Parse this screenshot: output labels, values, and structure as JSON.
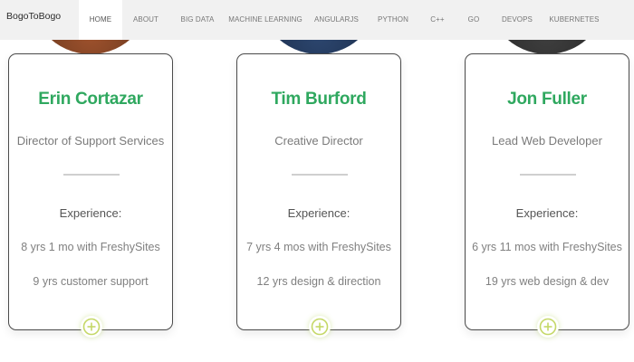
{
  "brand": "BogoToBogo",
  "nav": {
    "items": [
      {
        "label": "Home",
        "active": true
      },
      {
        "label": "About",
        "active": false
      },
      {
        "label": "Big Data",
        "active": false
      },
      {
        "label": "Machine Learning",
        "active": false
      },
      {
        "label": "AngularJS",
        "active": false
      },
      {
        "label": "Python",
        "active": false
      },
      {
        "label": "C++",
        "active": false
      },
      {
        "label": "go",
        "active": false
      },
      {
        "label": "DevOps",
        "active": false
      },
      {
        "label": "Kubernetes",
        "active": false
      }
    ]
  },
  "cards": [
    {
      "name": "Erin Cortazar",
      "role": "Director of Support Services",
      "experience_title": "Experience:",
      "experience": [
        "8 yrs 1 mo with FreshySites",
        "9 yrs customer support"
      ],
      "expand_icon": "plus-circle-icon"
    },
    {
      "name": "Tim Burford",
      "role": "Creative Director",
      "experience_title": "Experience:",
      "experience": [
        "7 yrs 4 mos with FreshySites",
        "12 yrs design & direction"
      ],
      "expand_icon": "plus-circle-icon"
    },
    {
      "name": "Jon Fuller",
      "role": "Lead Web Developer",
      "experience_title": "Experience:",
      "experience": [
        "6 yrs 11 mos with FreshySites",
        "19 yrs web design & dev"
      ],
      "expand_icon": "plus-circle-icon"
    }
  ],
  "colors": {
    "accent_green": "#2fa85f",
    "expand_icon": "#c5d867",
    "navbar_bg": "#f1f1f1"
  }
}
